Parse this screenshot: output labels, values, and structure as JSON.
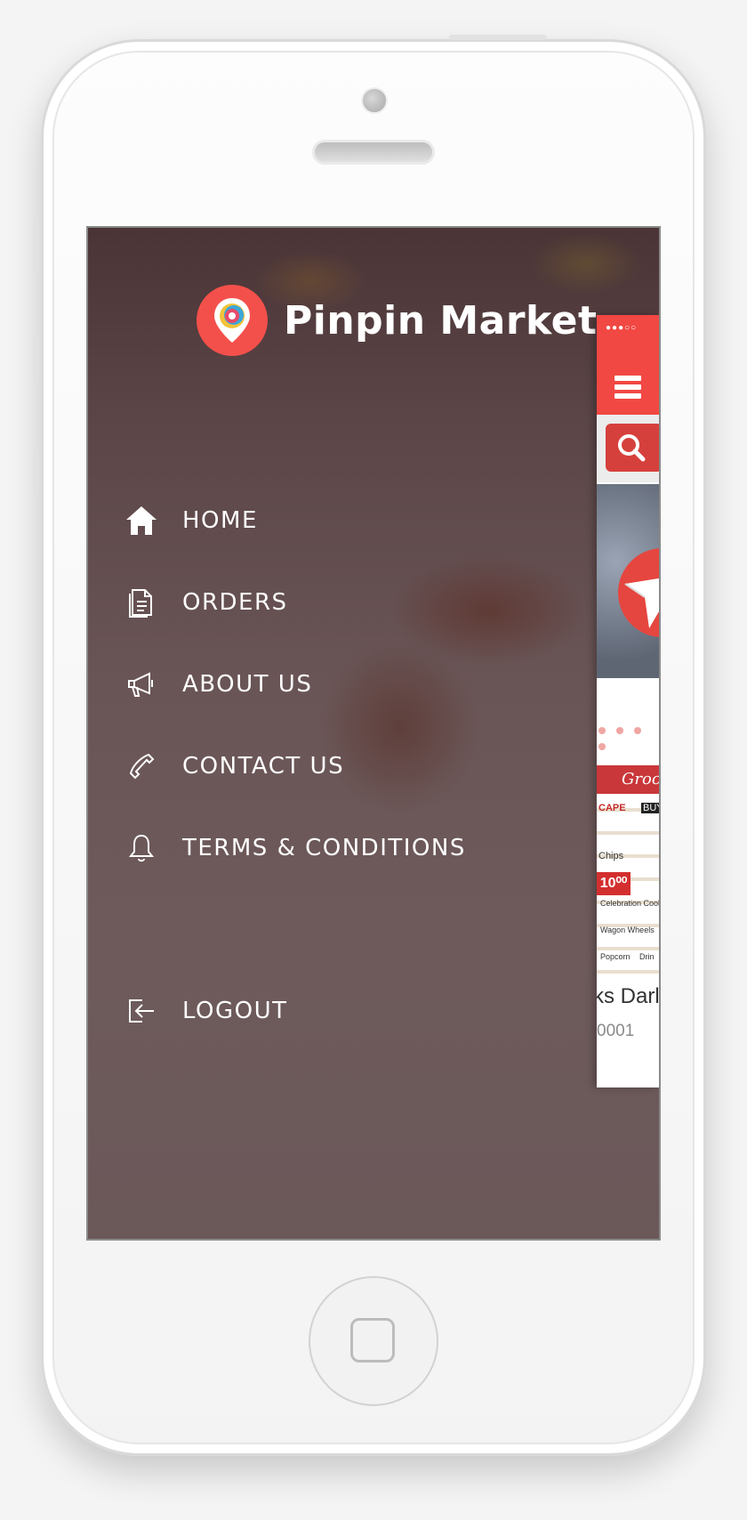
{
  "app": {
    "title": "Pinpin Market",
    "brand_color": "#f4504b"
  },
  "menu": {
    "items": [
      {
        "label": "HOME",
        "icon": "home-icon"
      },
      {
        "label": "ORDERS",
        "icon": "document-icon"
      },
      {
        "label": "ABOUT US",
        "icon": "megaphone-icon"
      },
      {
        "label": "CONTACT US",
        "icon": "phone-icon"
      },
      {
        "label": "TERMS & CONDITIONS",
        "icon": "bell-icon"
      }
    ],
    "logout": {
      "label": "LOGOUT",
      "icon": "logout-icon"
    }
  },
  "peek": {
    "status_dots": "●●●○○",
    "flyer_header": "Groc",
    "flyer_cells": [
      "CAPE",
      "Chips",
      "Celebration Cookies",
      "Wagon Wheels",
      "Popcorn",
      "Drin",
      "BUY"
    ],
    "flyer_price": "10⁰⁰",
    "product_name": "ks Darl",
    "product_code": "0001"
  }
}
